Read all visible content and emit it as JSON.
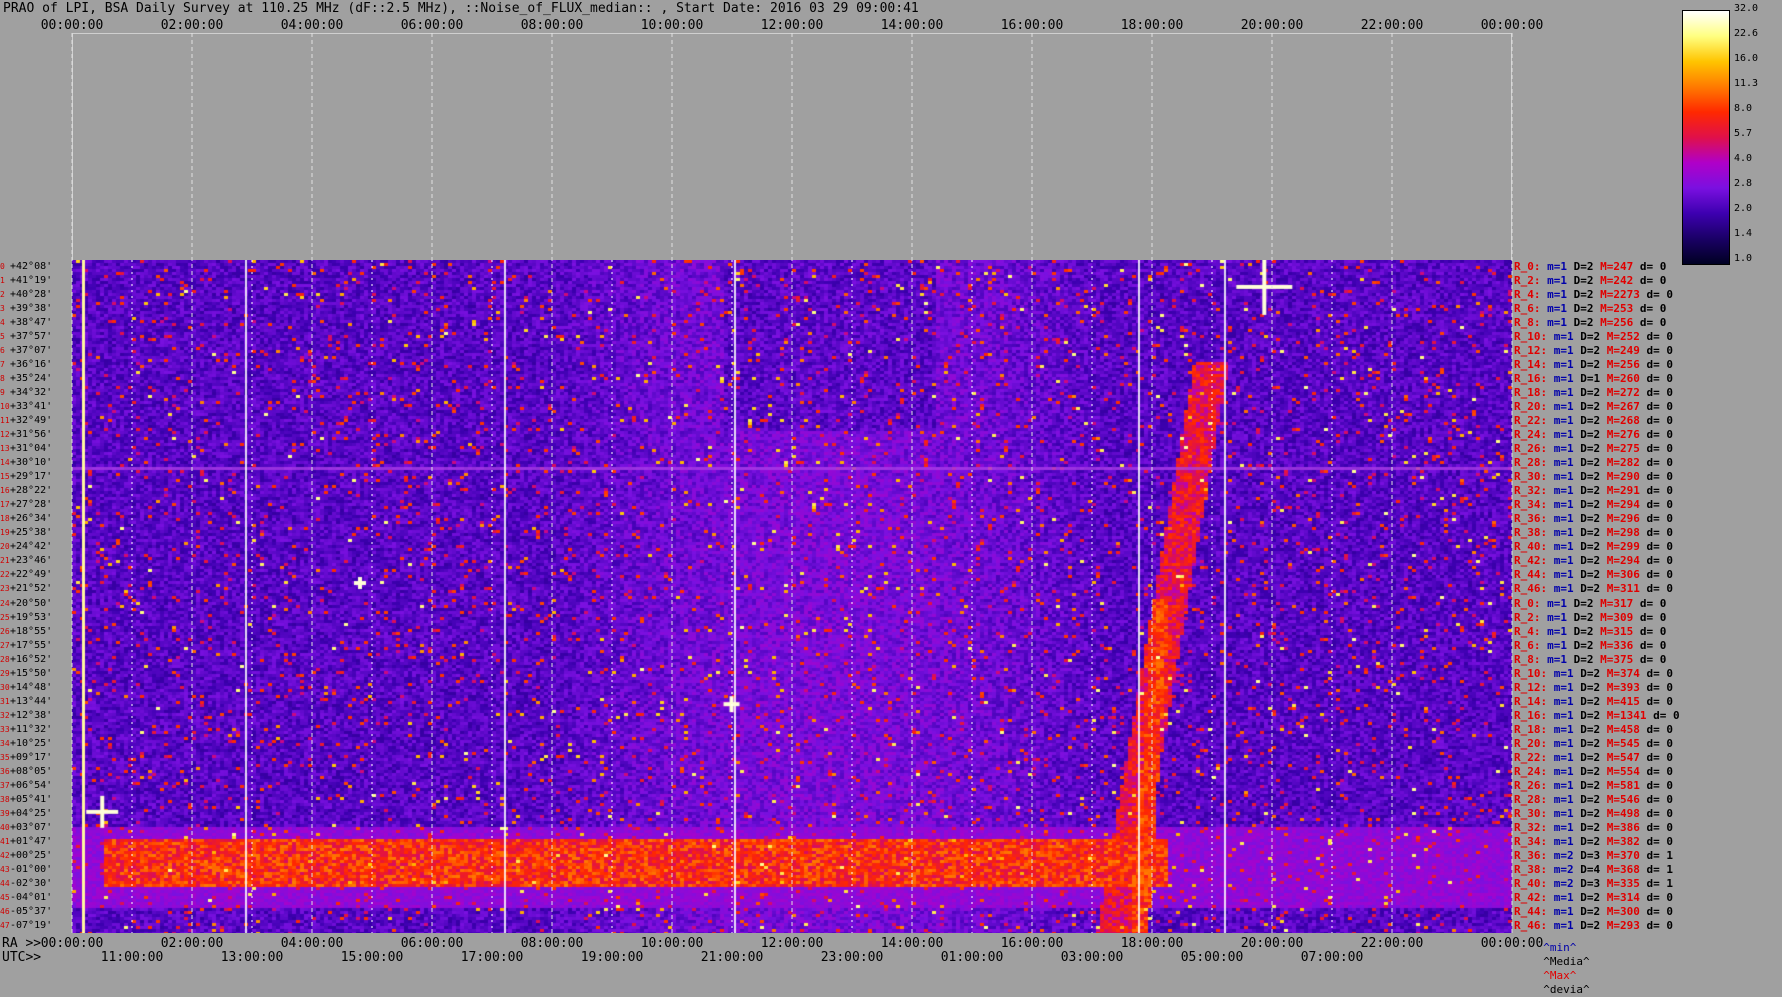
{
  "title": "PRAO of LPI, BSA Daily Survey at 110.25 MHz (dF::2.5 MHz), ::Noise_of_FLUX_median:: , Start Date: 2016 03 29 09:00:41",
  "axes": {
    "top_time_ticks": [
      "00:00:00",
      "02:00:00",
      "04:00:00",
      "06:00:00",
      "08:00:00",
      "10:00:00",
      "12:00:00",
      "14:00:00",
      "16:00:00",
      "18:00:00",
      "20:00:00",
      "22:00:00",
      "00:00:00"
    ],
    "bottom_ra_prefix": "RA >>",
    "bottom_ra_ticks": [
      "00:00:00",
      "02:00:00",
      "04:00:00",
      "06:00:00",
      "08:00:00",
      "10:00:00",
      "12:00:00",
      "14:00:00",
      "16:00:00",
      "18:00:00",
      "20:00:00",
      "22:00:00",
      "00:00:00"
    ],
    "bottom_utc_prefix": "UTC>>",
    "bottom_utc_ticks": [
      "11:00:00",
      "13:00:00",
      "15:00:00",
      "17:00:00",
      "19:00:00",
      "21:00:00",
      "23:00:00",
      "01:00:00",
      "03:00:00",
      "05:00:00",
      "07:00:00"
    ]
  },
  "colorbar": {
    "labels": [
      "32.0",
      "22.6",
      "16.0",
      "11.3",
      "8.0",
      "5.7",
      "4.0",
      "2.8",
      "2.0",
      "1.4",
      "1.0"
    ],
    "colors": [
      "#000022",
      "#1a0066",
      "#3d00b0",
      "#7a10e0",
      "#b000c8",
      "#e0104a",
      "#ff2800",
      "#ff7a00",
      "#ffc400",
      "#ffff80",
      "#ffffff"
    ]
  },
  "stats_legend": {
    "min": "^min^",
    "median": "^Media^",
    "max": "^Max^",
    "dev": "^devia^"
  },
  "legend_colors": {
    "min": "#0000aa",
    "median": "#000000",
    "max": "#e00000",
    "dev": "#000000"
  },
  "rows": [
    {
      "idx": "0",
      "dec": "+42°08'",
      "r": "R_0:",
      "min": "m=1",
      "med": "D=2",
      "max": "M=247",
      "dev": "d= 0"
    },
    {
      "idx": "1",
      "dec": "+41°19'",
      "r": "R_2:",
      "min": "m=1",
      "med": "D=2",
      "max": "M=242",
      "dev": "d= 0"
    },
    {
      "idx": "2",
      "dec": "+40°28'",
      "r": "R_4:",
      "min": "m=1",
      "med": "D=2",
      "max": "M=2273",
      "dev": "d= 0"
    },
    {
      "idx": "3",
      "dec": "+39°38'",
      "r": "R_6:",
      "min": "m=1",
      "med": "D=2",
      "max": "M=253",
      "dev": "d= 0"
    },
    {
      "idx": "4",
      "dec": "+38°47'",
      "r": "R_8:",
      "min": "m=1",
      "med": "D=2",
      "max": "M=256",
      "dev": "d= 0"
    },
    {
      "idx": "5",
      "dec": "+37°57'",
      "r": "R_10:",
      "min": "m=1",
      "med": "D=2",
      "max": "M=252",
      "dev": "d= 0"
    },
    {
      "idx": "6",
      "dec": "+37°07'",
      "r": "R_12:",
      "min": "m=1",
      "med": "D=2",
      "max": "M=249",
      "dev": "d= 0"
    },
    {
      "idx": "7",
      "dec": "+36°16'",
      "r": "R_14:",
      "min": "m=1",
      "med": "D=2",
      "max": "M=256",
      "dev": "d= 0"
    },
    {
      "idx": "8",
      "dec": "+35°24'",
      "r": "R_16:",
      "min": "m=1",
      "med": "D=1",
      "max": "M=260",
      "dev": "d= 0"
    },
    {
      "idx": "9",
      "dec": "+34°32'",
      "r": "R_18:",
      "min": "m=1",
      "med": "D=2",
      "max": "M=272",
      "dev": "d= 0"
    },
    {
      "idx": "10",
      "dec": "+33°41'",
      "r": "R_20:",
      "min": "m=1",
      "med": "D=2",
      "max": "M=267",
      "dev": "d= 0"
    },
    {
      "idx": "11",
      "dec": "+32°49'",
      "r": "R_22:",
      "min": "m=1",
      "med": "D=2",
      "max": "M=268",
      "dev": "d= 0"
    },
    {
      "idx": "12",
      "dec": "+31°56'",
      "r": "R_24:",
      "min": "m=1",
      "med": "D=2",
      "max": "M=276",
      "dev": "d= 0"
    },
    {
      "idx": "13",
      "dec": "+31°04'",
      "r": "R_26:",
      "min": "m=1",
      "med": "D=2",
      "max": "M=275",
      "dev": "d= 0"
    },
    {
      "idx": "14",
      "dec": "+30°10'",
      "r": "R_28:",
      "min": "m=1",
      "med": "D=2",
      "max": "M=282",
      "dev": "d= 0"
    },
    {
      "idx": "15",
      "dec": "+29°17'",
      "r": "R_30:",
      "min": "m=1",
      "med": "D=2",
      "max": "M=290",
      "dev": "d= 0"
    },
    {
      "idx": "16",
      "dec": "+28°22'",
      "r": "R_32:",
      "min": "m=1",
      "med": "D=2",
      "max": "M=291",
      "dev": "d= 0"
    },
    {
      "idx": "17",
      "dec": "+27°28'",
      "r": "R_34:",
      "min": "m=1",
      "med": "D=2",
      "max": "M=294",
      "dev": "d= 0"
    },
    {
      "idx": "18",
      "dec": "+26°34'",
      "r": "R_36:",
      "min": "m=1",
      "med": "D=2",
      "max": "M=296",
      "dev": "d= 0"
    },
    {
      "idx": "19",
      "dec": "+25°38'",
      "r": "R_38:",
      "min": "m=1",
      "med": "D=2",
      "max": "M=298",
      "dev": "d= 0"
    },
    {
      "idx": "20",
      "dec": "+24°42'",
      "r": "R_40:",
      "min": "m=1",
      "med": "D=2",
      "max": "M=299",
      "dev": "d= 0"
    },
    {
      "idx": "21",
      "dec": "+23°46'",
      "r": "R_42:",
      "min": "m=1",
      "med": "D=2",
      "max": "M=294",
      "dev": "d= 0"
    },
    {
      "idx": "22",
      "dec": "+22°49'",
      "r": "R_44:",
      "min": "m=1",
      "med": "D=2",
      "max": "M=306",
      "dev": "d= 0"
    },
    {
      "idx": "23",
      "dec": "+21°52'",
      "r": "R_46:",
      "min": "m=1",
      "med": "D=2",
      "max": "M=311",
      "dev": "d= 0"
    },
    {
      "idx": "24",
      "dec": "+20°50'",
      "r": "R_0:",
      "min": "m=1",
      "med": "D=2",
      "max": "M=317",
      "dev": "d= 0"
    },
    {
      "idx": "25",
      "dec": "+19°53'",
      "r": "R_2:",
      "min": "m=1",
      "med": "D=2",
      "max": "M=309",
      "dev": "d= 0"
    },
    {
      "idx": "26",
      "dec": "+18°55'",
      "r": "R_4:",
      "min": "m=1",
      "med": "D=2",
      "max": "M=315",
      "dev": "d= 0"
    },
    {
      "idx": "27",
      "dec": "+17°55'",
      "r": "R_6:",
      "min": "m=1",
      "med": "D=2",
      "max": "M=336",
      "dev": "d= 0"
    },
    {
      "idx": "28",
      "dec": "+16°52'",
      "r": "R_8:",
      "min": "m=1",
      "med": "D=2",
      "max": "M=375",
      "dev": "d= 0"
    },
    {
      "idx": "29",
      "dec": "+15°50'",
      "r": "R_10:",
      "min": "m=1",
      "med": "D=2",
      "max": "M=374",
      "dev": "d= 0"
    },
    {
      "idx": "30",
      "dec": "+14°48'",
      "r": "R_12:",
      "min": "m=1",
      "med": "D=2",
      "max": "M=393",
      "dev": "d= 0"
    },
    {
      "idx": "31",
      "dec": "+13°44'",
      "r": "R_14:",
      "min": "m=1",
      "med": "D=2",
      "max": "M=415",
      "dev": "d= 0"
    },
    {
      "idx": "32",
      "dec": "+12°38'",
      "r": "R_16:",
      "min": "m=1",
      "med": "D=2",
      "max": "M=1341",
      "dev": "d= 0"
    },
    {
      "idx": "33",
      "dec": "+11°32'",
      "r": "R_18:",
      "min": "m=1",
      "med": "D=2",
      "max": "M=458",
      "dev": "d= 0"
    },
    {
      "idx": "34",
      "dec": "+10°25'",
      "r": "R_20:",
      "min": "m=1",
      "med": "D=2",
      "max": "M=545",
      "dev": "d= 0"
    },
    {
      "idx": "35",
      "dec": "+09°17'",
      "r": "R_22:",
      "min": "m=1",
      "med": "D=2",
      "max": "M=547",
      "dev": "d= 0"
    },
    {
      "idx": "36",
      "dec": "+08°05'",
      "r": "R_24:",
      "min": "m=1",
      "med": "D=2",
      "max": "M=554",
      "dev": "d= 0"
    },
    {
      "idx": "37",
      "dec": "+06°54'",
      "r": "R_26:",
      "min": "m=1",
      "med": "D=2",
      "max": "M=581",
      "dev": "d= 0"
    },
    {
      "idx": "38",
      "dec": "+05°41'",
      "r": "R_28:",
      "min": "m=1",
      "med": "D=2",
      "max": "M=546",
      "dev": "d= 0"
    },
    {
      "idx": "39",
      "dec": "+04°25'",
      "r": "R_30:",
      "min": "m=1",
      "med": "D=2",
      "max": "M=498",
      "dev": "d= 0"
    },
    {
      "idx": "40",
      "dec": "+03°07'",
      "r": "R_32:",
      "min": "m=1",
      "med": "D=2",
      "max": "M=386",
      "dev": "d= 0"
    },
    {
      "idx": "41",
      "dec": "+01°47'",
      "r": "R_34:",
      "min": "m=1",
      "med": "D=2",
      "max": "M=382",
      "dev": "d= 0"
    },
    {
      "idx": "42",
      "dec": "+00°25'",
      "r": "R_36:",
      "min": "m=2",
      "med": "D=3",
      "max": "M=370",
      "dev": "d= 1"
    },
    {
      "idx": "43",
      "dec": "-01°00'",
      "r": "R_38:",
      "min": "m=2",
      "med": "D=4",
      "max": "M=368",
      "dev": "d= 1"
    },
    {
      "idx": "44",
      "dec": "-02°30'",
      "r": "R_40:",
      "min": "m=2",
      "med": "D=3",
      "max": "M=335",
      "dev": "d= 1"
    },
    {
      "idx": "45",
      "dec": "-04°01'",
      "r": "R_42:",
      "min": "m=1",
      "med": "D=2",
      "max": "M=314",
      "dev": "d= 0"
    },
    {
      "idx": "46",
      "dec": "-05°37'",
      "r": "R_44:",
      "min": "m=1",
      "med": "D=2",
      "max": "M=300",
      "dev": "d= 0"
    },
    {
      "idx": "47",
      "dec": "-07°19'",
      "r": "R_46:",
      "min": "m=1",
      "med": "D=2",
      "max": "M=293",
      "dev": "d= 0"
    }
  ],
  "chart_data": {
    "type": "heatmap",
    "title": "PRAO of LPI, BSA Daily Survey at 110.25 MHz (dF::2.5 MHz), ::Noise_of_FLUX_median:: , Start Date: 2016 03 29 09:00:41",
    "x_ticks_ra": [
      "00:00:00",
      "02:00:00",
      "04:00:00",
      "06:00:00",
      "08:00:00",
      "10:00:00",
      "12:00:00",
      "14:00:00",
      "16:00:00",
      "18:00:00",
      "20:00:00",
      "22:00:00",
      "00:00:00"
    ],
    "x_ticks_utc": [
      "11:00:00",
      "13:00:00",
      "15:00:00",
      "17:00:00",
      "19:00:00",
      "21:00:00",
      "23:00:00",
      "01:00:00",
      "03:00:00",
      "05:00:00",
      "07:00:00"
    ],
    "colorbar_scale": [
      1.0,
      1.4,
      2.0,
      2.8,
      4.0,
      5.7,
      8.0,
      11.3,
      16.0,
      22.6,
      32.0
    ],
    "row_count": 48
  }
}
